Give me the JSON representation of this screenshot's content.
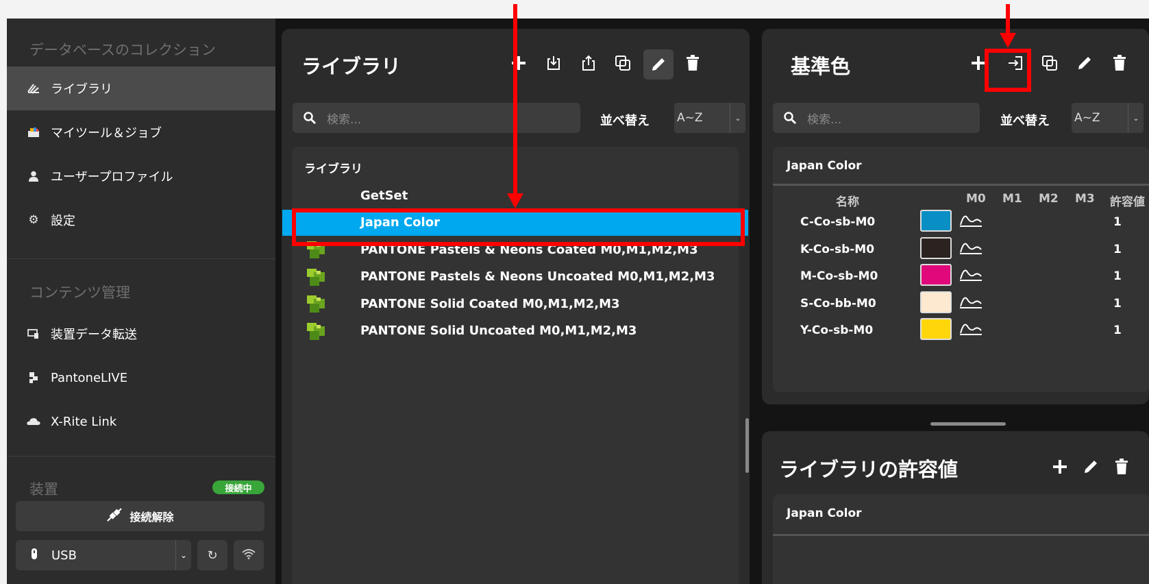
{
  "sidebar": {
    "collections_heading": "データベースのコレクション",
    "collections": [
      {
        "label": "ライブラリ",
        "icon": "library-icon",
        "active": true
      },
      {
        "label": "マイツール＆ジョブ",
        "icon": "toolbox-icon",
        "active": false
      },
      {
        "label": "ユーザープロファイル",
        "icon": "user-icon",
        "active": false
      },
      {
        "label": "設定",
        "icon": "gear-icon",
        "active": false
      }
    ],
    "content_heading": "コンテンツ管理",
    "content": [
      {
        "label": "装置データ転送",
        "icon": "device-transfer-icon"
      },
      {
        "label": "PantoneLIVE",
        "icon": "pantone-live-icon"
      },
      {
        "label": "X-Rite Link",
        "icon": "cloud-icon"
      }
    ],
    "device_heading": "装置",
    "connected_badge": "接続中",
    "disconnect_label": "接続解除",
    "connection_type": "USB"
  },
  "library_panel": {
    "title": "ライブラリ",
    "search_placeholder": "検索...",
    "sort_label": "並べ替え",
    "sort_value": "A~Z",
    "list_title": "ライブラリ",
    "items": [
      {
        "name": "GetSet",
        "icon": "none"
      },
      {
        "name": "Japan Color",
        "icon": "none",
        "selected": true
      },
      {
        "name": "PANTONE Pastels & Neons Coated M0,M1,M2,M3",
        "icon": "pantone-library-icon"
      },
      {
        "name": "PANTONE Pastels & Neons Uncoated M0,M1,M2,M3",
        "icon": "pantone-library-icon"
      },
      {
        "name": "PANTONE Solid Coated M0,M1,M2,M3",
        "icon": "pantone-library-icon"
      },
      {
        "name": "PANTONE Solid Uncoated M0,M1,M2,M3",
        "icon": "pantone-library-icon"
      }
    ]
  },
  "standards_panel": {
    "title": "基準色",
    "search_placeholder": "検索...",
    "sort_label": "並べ替え",
    "sort_value": "A~Z",
    "table_title": "Japan Color",
    "columns": [
      "名称",
      "M0",
      "M1",
      "M2",
      "M3",
      "許容値"
    ],
    "rows": [
      {
        "name": "C-Co-sb-M0",
        "color": "#0a8fc4",
        "tolerance": "1"
      },
      {
        "name": "K-Co-sb-M0",
        "color": "#2a2320",
        "tolerance": "1"
      },
      {
        "name": "M-Co-sb-M0",
        "color": "#e0087a",
        "tolerance": "1"
      },
      {
        "name": "S-Co-bb-M0",
        "color": "#fde9cf",
        "tolerance": "1"
      },
      {
        "name": "Y-Co-sb-M0",
        "color": "#ffd60a",
        "tolerance": "1"
      }
    ]
  },
  "tolerance_panel": {
    "title": "ライブラリの許容値",
    "table_title": "Japan Color"
  },
  "colors": {
    "selection": "#00a8f0",
    "annotation": "#ff0000",
    "connected": "#39a63a"
  }
}
